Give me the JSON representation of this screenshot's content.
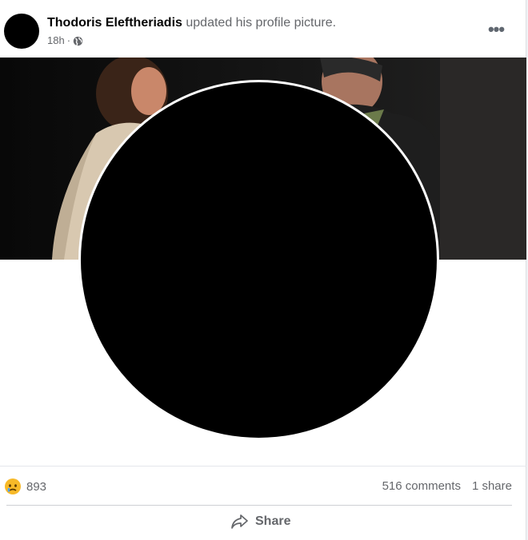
{
  "post": {
    "author": "Thodoris Eleftheriadis",
    "action": "updated his profile picture.",
    "time": "18h",
    "separator": "·",
    "audience_icon": "globe-icon",
    "more_icon": "more-horizontal-icon",
    "more_label": "•••"
  },
  "stats": {
    "reaction_icon": "sad-face-icon",
    "reaction_count": "893",
    "comments": "516 comments",
    "shares": "1 share"
  },
  "actions": {
    "share_label": "Share",
    "share_icon": "share-arrow-icon"
  },
  "colors": {
    "secondary_text": "#65676b",
    "divider": "#ced0d4",
    "sad_emoji": "#f7b928"
  }
}
